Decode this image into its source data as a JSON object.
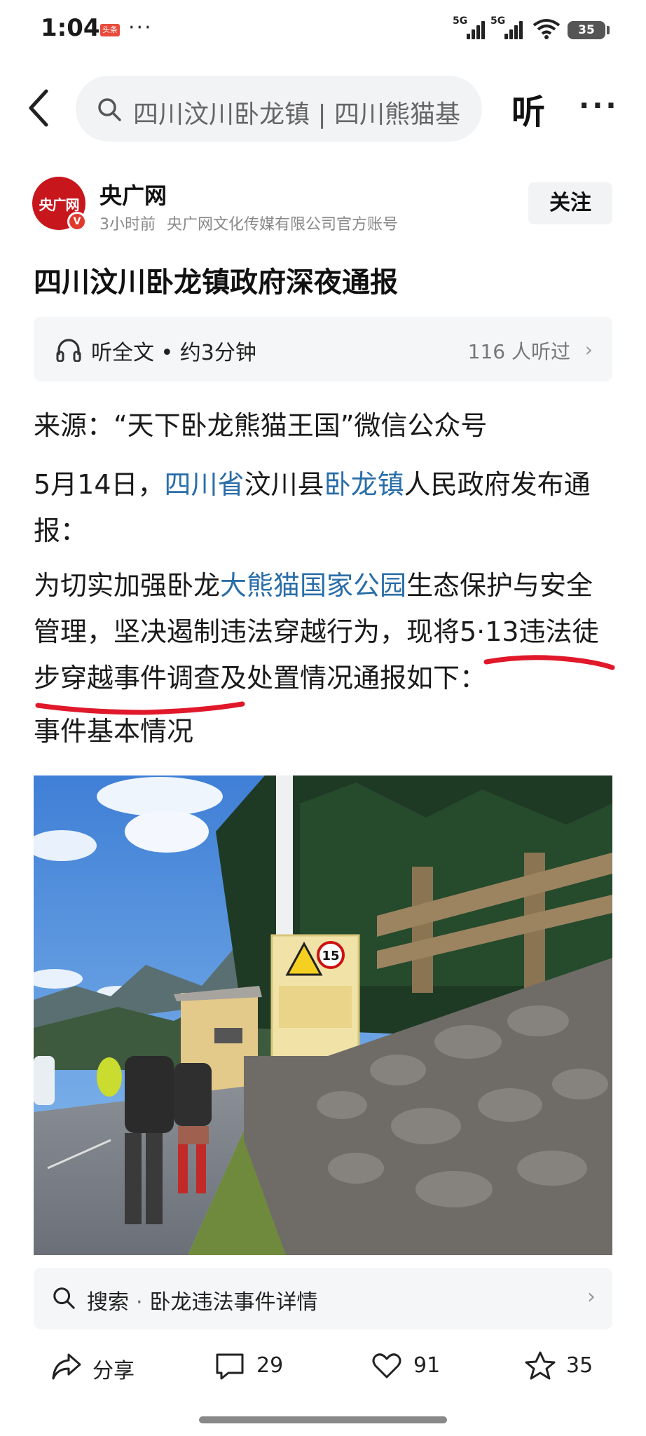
{
  "status_bar": {
    "time": "1:04",
    "app_badge": "头条",
    "more": "···",
    "signal1_label": "5G",
    "signal2_label": "5G",
    "battery": "35"
  },
  "top_nav": {
    "search_text": "四川汶川卧龙镇 | 四川熊猫基",
    "listen_label": "听",
    "more_label": "···"
  },
  "author": {
    "avatar_text": "央广网",
    "name": "央广网",
    "time": "3小时前",
    "description": "央广网文化传媒有限公司官方账号",
    "follow_label": "关注"
  },
  "article": {
    "title": "四川汶川卧龙镇政府深夜通报",
    "listen_full": "听全文 • 约3分钟",
    "listen_count": "116 人听过",
    "source_line": "来源：“天下卧龙熊猫王国”微信公众号",
    "p2_a": "5月14日，",
    "p2_link1": "四川省",
    "p2_b": "汶川县",
    "p2_link2": "卧龙镇",
    "p2_c": "人民政府发布通报：",
    "p3_a": "为切实加强卧龙",
    "p3_link": "大熊猫国家公园",
    "p3_b": "生态保护与安全管理，坚决遏制违法穿越行为，现将5·13违法徒步穿越事件调查及处置情况通报如下：",
    "section_heading": "事件基本情况",
    "sign_number": "15"
  },
  "search_suggest": {
    "label": "搜索",
    "query": "卧龙违法事件详情"
  },
  "actions": {
    "share": "分享",
    "comments": "29",
    "likes": "91",
    "favorites": "35"
  },
  "colors": {
    "link": "#2a6ea8",
    "brand_red": "#c8161d",
    "annotation_red": "#e0182a"
  }
}
